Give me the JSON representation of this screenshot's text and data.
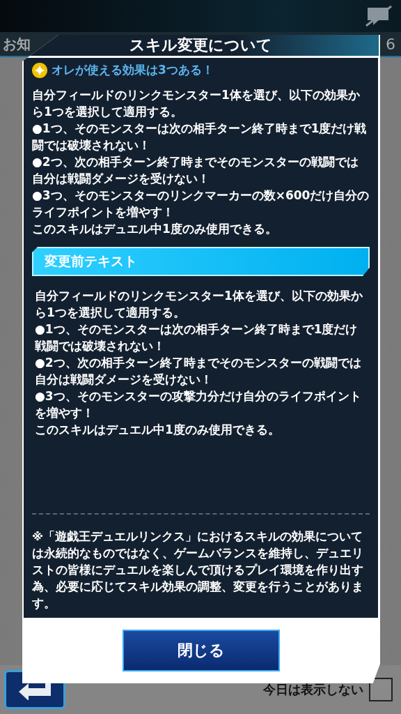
{
  "background": {
    "header_title": "お知",
    "header_count": "6",
    "dont_show_today": {
      "label": "今日は表示しない",
      "checked": false
    }
  },
  "dialog": {
    "title": "スキル変更について",
    "skill_line": "オレが使える効果は3つある！",
    "current_text": [
      "自分フィールドのリンクモンスター1体を選び、以下の効果から1つを選択して適用する。",
      "●1つ、そのモンスターは次の相手ターン終了時まで1度だけ戦闘では破壊されない！",
      "●2つ、次の相手ターン終了時までそのモンスターの戦闘では自分は戦闘ダメージを受けない！",
      "●3つ、そのモンスターのリンクマーカーの数×600だけ自分のライフポイントを増やす！",
      "このスキルはデュエル中1度のみ使用できる。"
    ],
    "section_heading": "変更前テキスト",
    "previous_text": [
      "自分フィールドのリンクモンスター1体を選び、以下の効果から1つを選択して適用する。",
      "●1つ、そのモンスターは次の相手ターン終了時まで1度だけ戦闘では破壊されない！",
      "●2つ、次の相手ターン終了時までそのモンスターの戦闘では自分は戦闘ダメージを受けない！",
      "●3つ、そのモンスターの攻撃力分だけ自分のライフポイントを増やす！",
      "このスキルはデュエル中1度のみ使用できる。"
    ],
    "note": "※「遊戯王デュエルリンクス」におけるスキルの効果については永続的なものではなく、ゲームバランスを維持し、デュエリストの皆様にデュエルを楽しんで頂けるプレイ環境を作り出す為、必要に応じてスキル効果の調整、変更を行うことがあります。",
    "close_button": "閉じる"
  }
}
